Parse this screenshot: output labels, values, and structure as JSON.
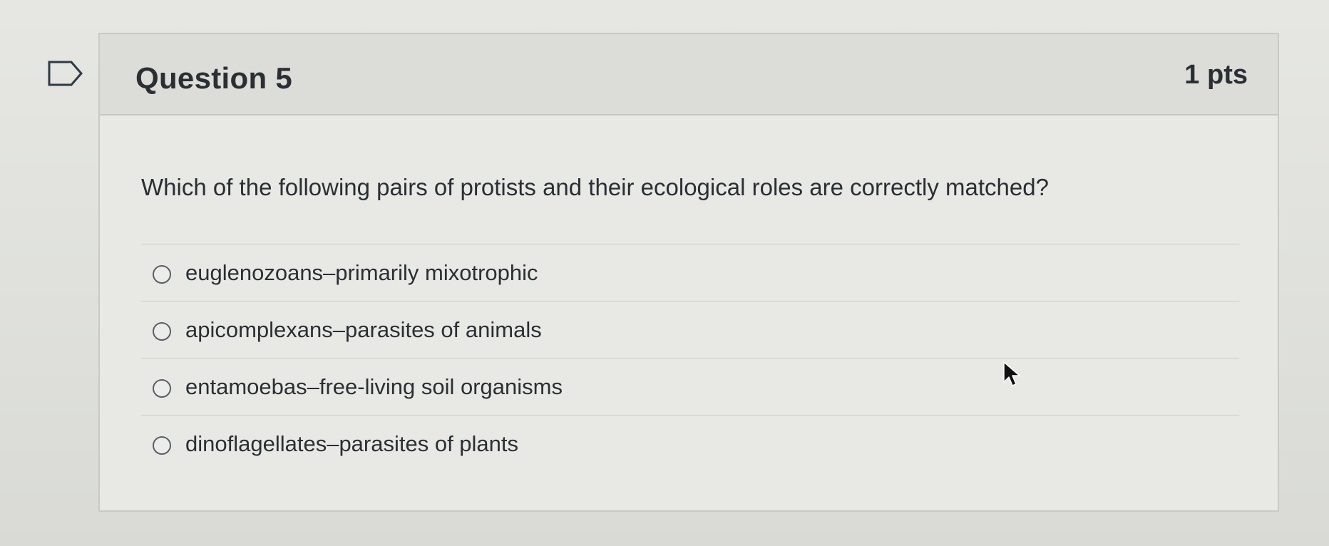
{
  "question": {
    "title": "Question 5",
    "points": "1 pts",
    "text": "Which of the following pairs of protists and their ecological roles are correctly matched?",
    "answers": [
      {
        "label": "euglenozoans–primarily mixotrophic"
      },
      {
        "label": "apicomplexans–parasites of animals"
      },
      {
        "label": "entamoebas–free-living soil organisms"
      },
      {
        "label": "dinoflagellates–parasites of plants"
      }
    ]
  },
  "icons": {
    "flag": "flag-question-icon",
    "cursor": "mouse-pointer-icon",
    "radio": "radio-unselected-icon"
  }
}
